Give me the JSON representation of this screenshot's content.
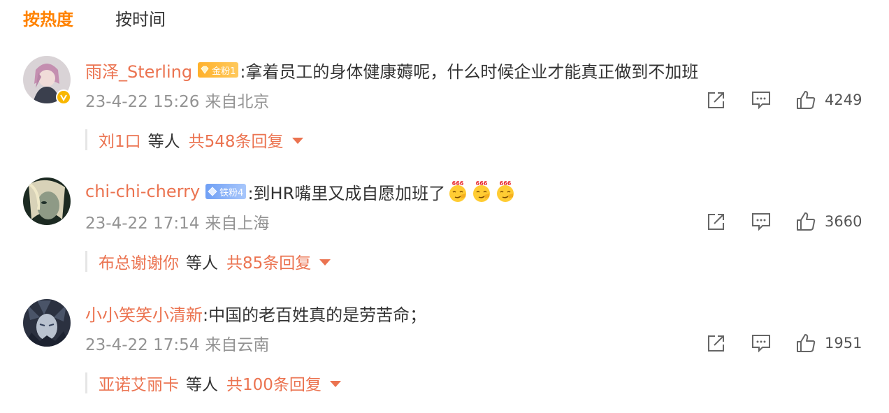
{
  "tabs": {
    "hot": "按热度",
    "time": "按时间"
  },
  "comments": [
    {
      "username": "雨泽_Sterling",
      "badge": "金粉1",
      "badge_type": "gold",
      "verified": true,
      "text": ":拿着员工的身体健康薅呢，什么时候企业才能真正做到不加班",
      "time": "23-4-22 15:26",
      "location": "来自北京",
      "likes": "4249",
      "reply_users": "刘1口",
      "reply_etc": "等人",
      "reply_total": "共548条回复"
    },
    {
      "username": "chi-chi-cherry",
      "badge": "铁粉4",
      "badge_type": "iron",
      "verified": false,
      "text": ":到HR嘴里又成自愿加班了",
      "emoji_count": 3,
      "emoji_label": "666",
      "time": "23-4-22 17:14",
      "location": "来自上海",
      "likes": "3660",
      "reply_users": "布总谢谢你",
      "reply_etc": "等人",
      "reply_total": "共85条回复"
    },
    {
      "username": "小小笑笑小清新",
      "verified": false,
      "text": ":中国的老百姓真的是劳苦命；",
      "time": "23-4-22 17:54",
      "location": "来自云南",
      "likes": "1951",
      "reply_users": "亚诺艾丽卡",
      "reply_etc": "等人",
      "reply_total": "共100条回复"
    }
  ],
  "colors": {
    "accent": "#ff8200",
    "username": "#eb7350",
    "meta": "#939393",
    "badge_gold": "#ffb12b",
    "badge_iron": "#6f9ff5"
  },
  "icons": [
    "share-icon",
    "comment-icon",
    "like-icon",
    "verified-icon",
    "caret-down-icon"
  ]
}
